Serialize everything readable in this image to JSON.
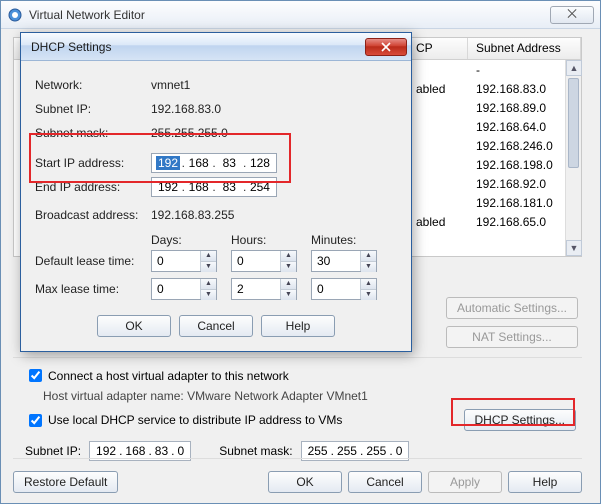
{
  "main_window": {
    "title": "Virtual Network Editor",
    "close_glyph": "⨉"
  },
  "table": {
    "headers": {
      "dhcp": "CP",
      "subnet": "Subnet Address"
    },
    "rows": [
      {
        "dhcp": "",
        "subnet": "-"
      },
      {
        "dhcp": "abled",
        "subnet": "192.168.83.0"
      },
      {
        "dhcp": "",
        "subnet": "192.168.89.0"
      },
      {
        "dhcp": "",
        "subnet": "192.168.64.0"
      },
      {
        "dhcp": "",
        "subnet": "192.168.246.0"
      },
      {
        "dhcp": "",
        "subnet": "192.168.198.0"
      },
      {
        "dhcp": "",
        "subnet": "192.168.92.0"
      },
      {
        "dhcp": "",
        "subnet": "192.168.181.0"
      },
      {
        "dhcp": "abled",
        "subnet": "192.168.65.0"
      }
    ]
  },
  "right_buttons": {
    "auto": "Automatic Settings...",
    "nat": "NAT Settings..."
  },
  "host_adapter": {
    "connect_label": "Connect a host virtual adapter to this network",
    "name_label": "Host virtual adapter name: VMware Network Adapter VMnet1"
  },
  "dhcp_section": {
    "use_label": "Use local DHCP service to distribute IP address to VMs",
    "button": "DHCP Settings..."
  },
  "subnet_row": {
    "ip_label": "Subnet IP:",
    "ip": [
      "192",
      "168",
      "83",
      "0"
    ],
    "mask_label": "Subnet mask:",
    "mask": [
      "255",
      "255",
      "255",
      "0"
    ]
  },
  "bottom": {
    "restore": "Restore Default",
    "ok": "OK",
    "cancel": "Cancel",
    "apply": "Apply",
    "help": "Help"
  },
  "dialog": {
    "title": "DHCP Settings",
    "network_label": "Network:",
    "network": "vmnet1",
    "subnet_ip_label": "Subnet IP:",
    "subnet_ip": "192.168.83.0",
    "subnet_mask_label": "Subnet mask:",
    "subnet_mask": "255.255.255.0",
    "start_ip_label": "Start IP address:",
    "start_ip": [
      "192",
      "168",
      "83",
      "128"
    ],
    "end_ip_label": "End IP address:",
    "end_ip": [
      "192",
      "168",
      "83",
      "254"
    ],
    "broadcast_label": "Broadcast address:",
    "broadcast": "192.168.83.255",
    "days": "Days:",
    "hours": "Hours:",
    "minutes": "Minutes:",
    "default_lease_label": "Default lease time:",
    "default_lease": {
      "days": "0",
      "hours": "0",
      "minutes": "30"
    },
    "max_lease_label": "Max lease time:",
    "max_lease": {
      "days": "0",
      "hours": "2",
      "minutes": "0"
    },
    "ok": "OK",
    "cancel": "Cancel",
    "help": "Help"
  }
}
